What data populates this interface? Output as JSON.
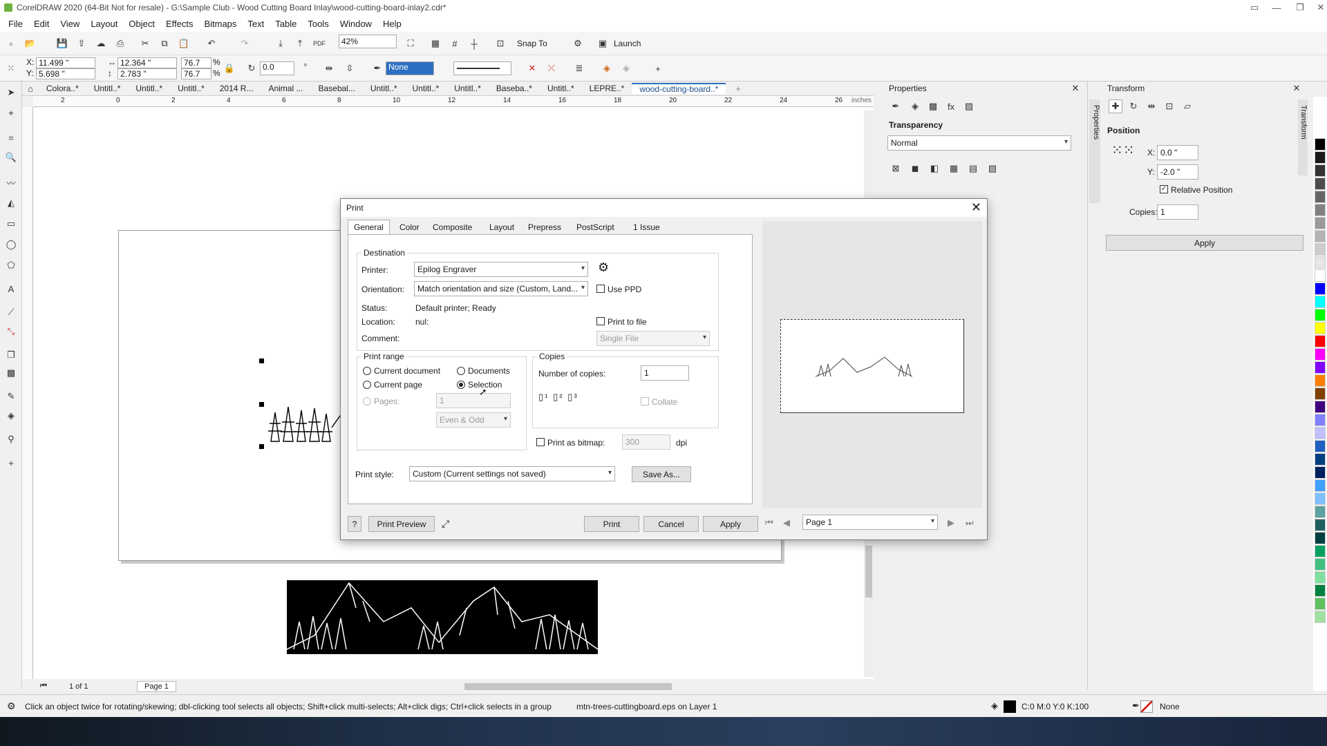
{
  "window": {
    "title": "CorelDRAW 2020 (64-Bit Not for resale) - G:\\Sample Club - Wood Cutting Board Inlay\\wood-cutting-board-inlay2.cdr*"
  },
  "menu": [
    "File",
    "Edit",
    "View",
    "Layout",
    "Object",
    "Effects",
    "Bitmaps",
    "Text",
    "Table",
    "Tools",
    "Window",
    "Help"
  ],
  "std_toolbar": {
    "zoom": "42%",
    "snap_to": "Snap To",
    "launch": "Launch"
  },
  "prop_toolbar": {
    "x": "11.499 \"",
    "y": "5.698 \"",
    "w": "12.364 \"",
    "h": "2.783 \"",
    "sx": "76.7",
    "sy": "76.7",
    "pct1": "%",
    "pct2": "%",
    "angle": "0.0",
    "fill": "None"
  },
  "doc_tabs": [
    "Colora..*",
    "Untitl..*",
    "Untitl..*",
    "Untitl..*",
    "2014 R...",
    "Animal ...",
    "Basebal...",
    "Untitl..*",
    "Untitl..*",
    "Untitl..*",
    "Baseba..*",
    "Untitl..*",
    "LEPRE..*",
    "wood-cutting-board..*"
  ],
  "ruler": {
    "unit": "inches",
    "ticks": [
      "2",
      "0",
      "2",
      "4",
      "6",
      "8",
      "10",
      "12",
      "14",
      "16",
      "18",
      "20",
      "22",
      "24",
      "26"
    ]
  },
  "properties_panel": {
    "title": "Properties",
    "section": "Transparency",
    "mode": "Normal",
    "side_tab": "Properties"
  },
  "transform_panel": {
    "title": "Transform",
    "section": "Position",
    "x_label": "X:",
    "x": "0.0 \"",
    "y_label": "Y:",
    "y": "-2.0 \"",
    "relative": "Relative Position",
    "copies_label": "Copies:",
    "copies": "1",
    "apply": "Apply",
    "side_tab": "Transform"
  },
  "page_nav": {
    "count": "1 of 1",
    "page": "Page 1"
  },
  "status": {
    "hint": "Click an object twice for rotating/skewing; dbl-clicking tool selects all objects; Shift+click multi-selects; Alt+click digs; Ctrl+click selects in a group",
    "object": "mtn-trees-cuttingboard.eps on Layer 1",
    "fill_cmyk": "C:0 M:0 Y:0 K:100",
    "outline": "None"
  },
  "palette": [
    "#000000",
    "#1a1a1a",
    "#333333",
    "#4d4d4d",
    "#666666",
    "#808080",
    "#999999",
    "#b3b3b3",
    "#cccccc",
    "#e6e6e6",
    "#ffffff",
    "#0000ff",
    "#00ffff",
    "#00ff00",
    "#ffff00",
    "#ff0000",
    "#ff00ff",
    "#8000ff",
    "#ff8000",
    "#804000",
    "#400080",
    "#8080ff",
    "#c0c0ff",
    "#2060c0",
    "#004080",
    "#002060",
    "#40a0ff",
    "#80c0ff",
    "#60a0a0",
    "#206060",
    "#004040",
    "#00a060",
    "#40c080",
    "#80e0a0",
    "#008040",
    "#60c060",
    "#a0e0a0"
  ],
  "dialog": {
    "title": "Print",
    "tabs": [
      "General",
      "Color",
      "Composite",
      "Layout",
      "Prepress",
      "PostScript",
      "1 Issue"
    ],
    "destination": {
      "label": "Destination",
      "printer_label": "Printer:",
      "printer": "Epilog Engraver",
      "orientation_label": "Orientation:",
      "orientation": "Match orientation and size (Custom, Land...",
      "use_ppd": "Use PPD",
      "status_label": "Status:",
      "status": "Default printer; Ready",
      "location_label": "Location:",
      "location": "nul:",
      "print_to_file": "Print to file",
      "comment_label": "Comment:",
      "file_mode": "Single File"
    },
    "range": {
      "label": "Print range",
      "current_document": "Current document",
      "documents": "Documents",
      "current_page": "Current page",
      "selection": "Selection",
      "pages": "Pages:",
      "pages_value": "1",
      "even_odd": "Even & Odd"
    },
    "copies": {
      "label": "Copies",
      "number_label": "Number of copies:",
      "number": "1",
      "collate": "Collate"
    },
    "bitmap": {
      "label": "Print as bitmap:",
      "dpi_value": "300",
      "dpi": "dpi"
    },
    "print_style_label": "Print style:",
    "print_style": "Custom (Current settings not saved)",
    "save_as": "Save As...",
    "help": "?",
    "print_preview": "Print Preview",
    "print": "Print",
    "cancel": "Cancel",
    "apply": "Apply",
    "preview_page": "Page 1"
  }
}
